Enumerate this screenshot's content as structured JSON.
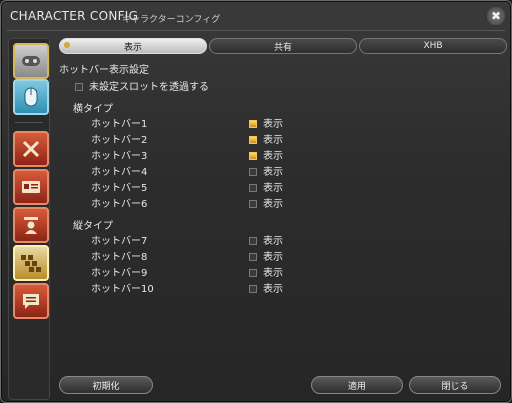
{
  "window": {
    "title_en": "CHARACTER CONFIG",
    "title_jp": "キャラクターコンフィグ",
    "close_symbol": "✖"
  },
  "sidebar": {
    "items": [
      {
        "icon": "gamepad-icon",
        "glyph": "🎮"
      },
      {
        "icon": "mouse-icon",
        "glyph": "🖱"
      },
      {
        "icon": "crossed-swords-icon",
        "glyph": "✕"
      },
      {
        "icon": "id-card-icon",
        "glyph": "▤"
      },
      {
        "icon": "character-icon",
        "glyph": "👤"
      },
      {
        "icon": "hotbar-grid-icon",
        "glyph": "▦"
      },
      {
        "icon": "chat-bubble-icon",
        "glyph": "☰"
      }
    ]
  },
  "tabs": [
    {
      "label": "表示",
      "active": true
    },
    {
      "label": "共有",
      "active": false
    },
    {
      "label": "XHB",
      "active": false
    }
  ],
  "content": {
    "section_title": "ホットバー表示設定",
    "transparent_option": {
      "label": "未設定スロットを透過する",
      "checked": false
    },
    "horizontal": {
      "heading": "横タイプ",
      "items": [
        {
          "label": "ホットバー1",
          "option": "表示",
          "checked": true
        },
        {
          "label": "ホットバー2",
          "option": "表示",
          "checked": true
        },
        {
          "label": "ホットバー3",
          "option": "表示",
          "checked": true
        },
        {
          "label": "ホットバー4",
          "option": "表示",
          "checked": false
        },
        {
          "label": "ホットバー5",
          "option": "表示",
          "checked": false
        },
        {
          "label": "ホットバー6",
          "option": "表示",
          "checked": false
        }
      ]
    },
    "vertical": {
      "heading": "縦タイプ",
      "items": [
        {
          "label": "ホットバー7",
          "option": "表示",
          "checked": false
        },
        {
          "label": "ホットバー8",
          "option": "表示",
          "checked": false
        },
        {
          "label": "ホットバー9",
          "option": "表示",
          "checked": false
        },
        {
          "label": "ホットバー10",
          "option": "表示",
          "checked": false
        }
      ]
    }
  },
  "buttons": {
    "reset": "初期化",
    "apply": "適用",
    "close": "閉じる"
  },
  "colors": {
    "accent_gold": "#d9a63a",
    "checkbox_on": "#f4c45a"
  }
}
